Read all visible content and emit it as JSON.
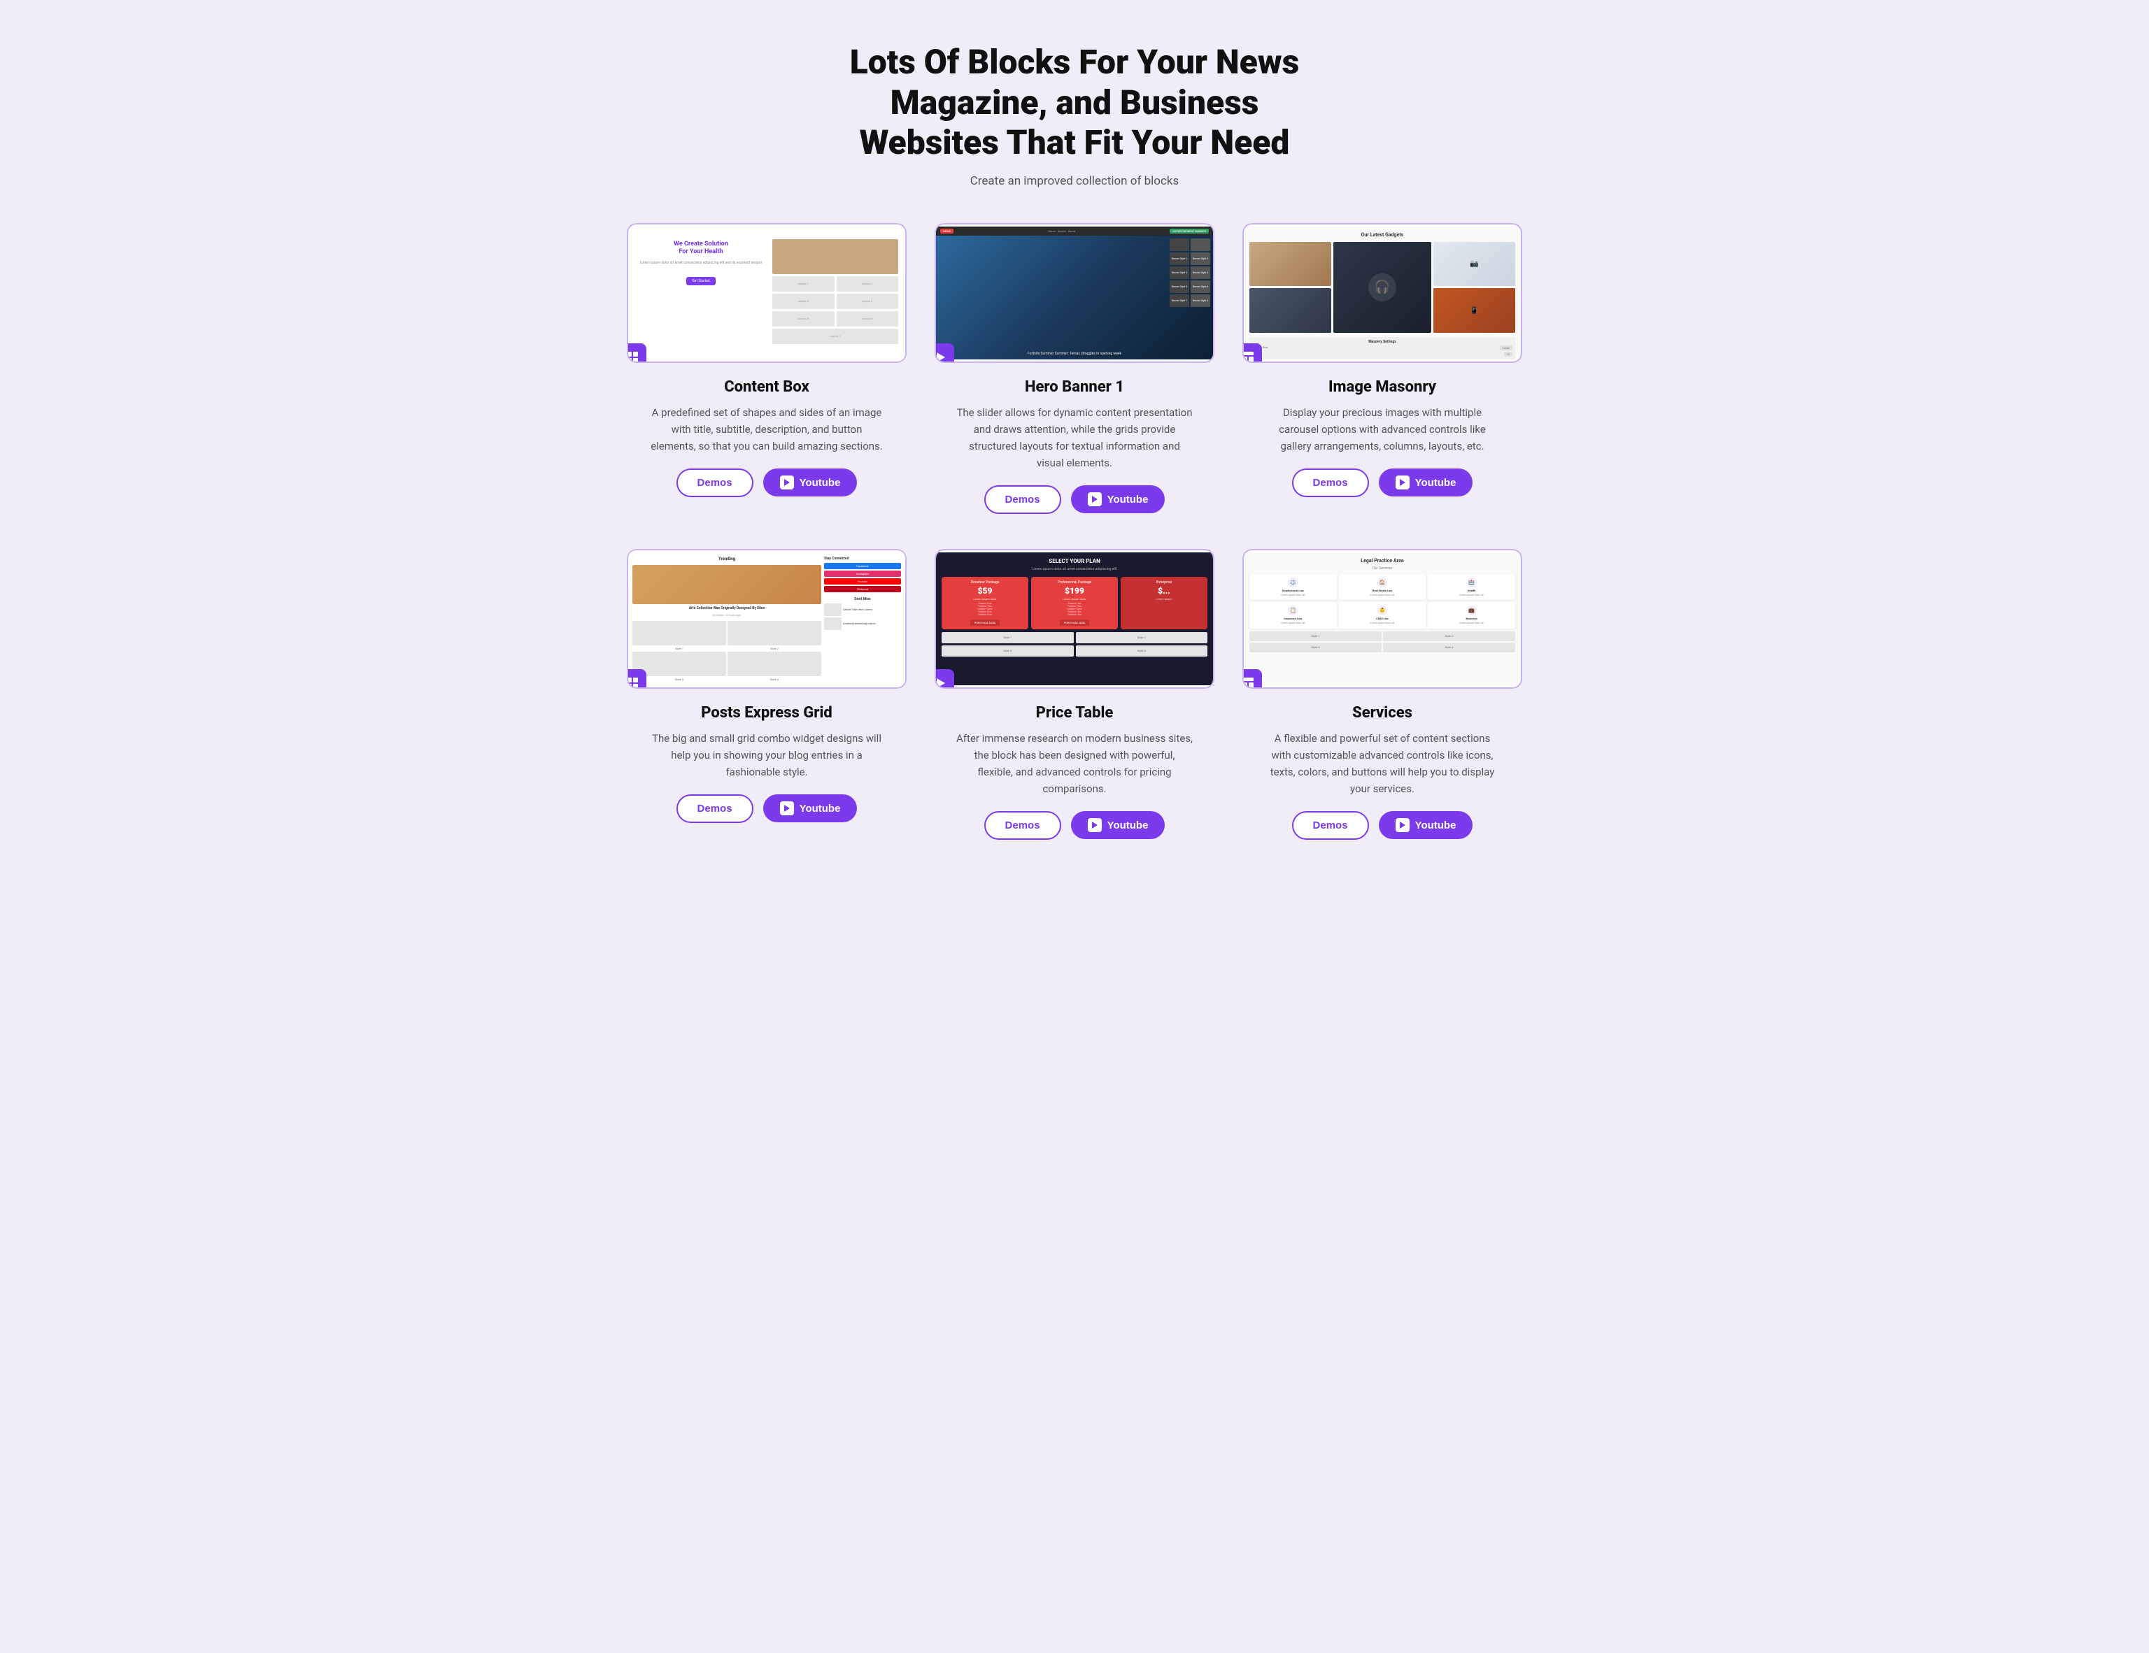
{
  "header": {
    "title": "Lots Of Blocks For Your News Magazine, and Business Websites That Fit Your Need",
    "subtitle": "Create an improved collection of blocks"
  },
  "blocks": [
    {
      "id": "content-box",
      "title": "Content Box",
      "description": "A predefined set of shapes and sides of an image with title, subtitle, description, and button elements, so that you can build amazing sections.",
      "demos_label": "Demos",
      "youtube_label": "Youtube",
      "preview_type": "content-box",
      "badge_icon": "grid-icon"
    },
    {
      "id": "hero-banner",
      "title": "Hero Banner 1",
      "description": "The slider allows for dynamic content presentation and draws attention, while the grids provide structured layouts for textual information and visual elements.",
      "demos_label": "Demos",
      "youtube_label": "Youtube",
      "preview_type": "hero-banner",
      "badge_icon": "play-icon"
    },
    {
      "id": "image-masonry",
      "title": "Image Masonry",
      "description": "Display your precious images with multiple carousel options with advanced controls like gallery arrangements, columns, layouts, etc.",
      "demos_label": "Demos",
      "youtube_label": "Youtube",
      "preview_type": "masonry",
      "badge_icon": "layout-icon"
    },
    {
      "id": "posts-express-grid",
      "title": "Posts Express Grid",
      "description": "The big and small grid combo widget designs will help you in showing your blog entries in a fashionable style.",
      "demos_label": "Demos",
      "youtube_label": "Youtube",
      "preview_type": "posts-grid",
      "badge_icon": "grid-icon"
    },
    {
      "id": "price-table",
      "title": "Price Table",
      "description": "After immense research on modern business sites, the block has been designed with powerful, flexible, and advanced controls for pricing comparisons.",
      "demos_label": "Demos",
      "youtube_label": "Youtube",
      "preview_type": "price-table",
      "badge_icon": "play-icon"
    },
    {
      "id": "services",
      "title": "Services",
      "description": "A flexible and powerful set of content sections with customizable advanced controls like icons, texts, colors, and buttons will help you to display your services.",
      "demos_label": "Demos",
      "youtube_label": "Youtube",
      "preview_type": "services",
      "badge_icon": "layout-icon"
    }
  ]
}
